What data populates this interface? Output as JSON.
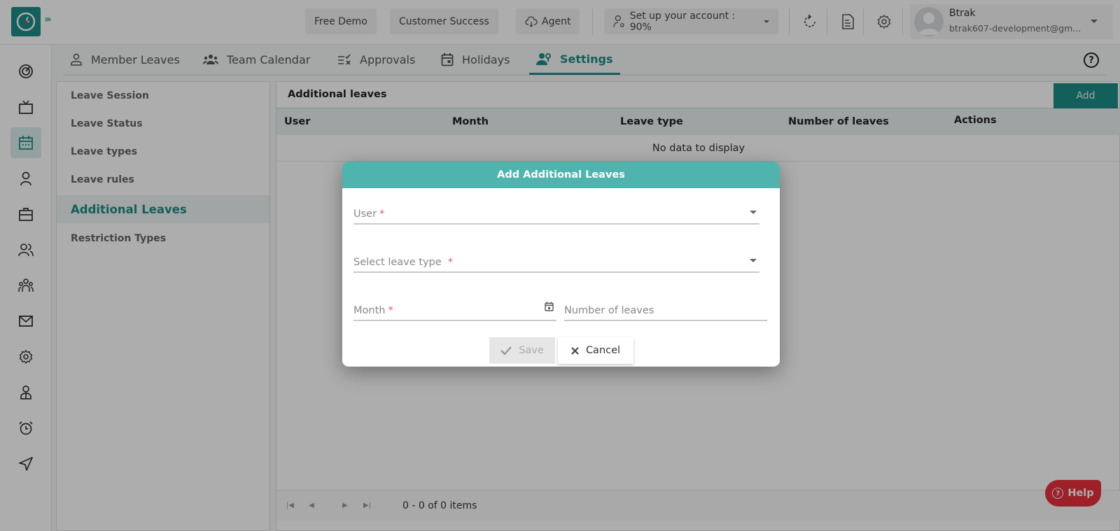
{
  "topbar": {
    "buttons": {
      "free_demo": "Free Demo",
      "customer_success": "Customer Success",
      "agent": "Agent",
      "setup_account": "Set up your account : 90%"
    },
    "setup_progress_percent": 90,
    "user": {
      "name": "Btrak",
      "email": "btrak607-development@gm..."
    }
  },
  "rail": {
    "items": [
      {
        "icon": "dashboard-icon"
      },
      {
        "icon": "tv-icon"
      },
      {
        "icon": "calendar-icon",
        "active": true
      },
      {
        "icon": "user-icon"
      },
      {
        "icon": "briefcase-icon"
      },
      {
        "icon": "users-icon"
      },
      {
        "icon": "team-icon"
      },
      {
        "icon": "mail-icon"
      },
      {
        "icon": "gear-icon"
      },
      {
        "icon": "employee-icon"
      },
      {
        "icon": "alarm-icon"
      },
      {
        "icon": "send-icon"
      }
    ]
  },
  "tabs": [
    {
      "label": "Member Leaves",
      "icon": "person-icon"
    },
    {
      "label": "Team Calendar",
      "icon": "group-icon"
    },
    {
      "label": "Approvals",
      "icon": "checklist-icon"
    },
    {
      "label": "Holidays",
      "icon": "calendar-icon"
    },
    {
      "label": "Settings",
      "icon": "user-gear-icon",
      "active": true
    }
  ],
  "settings_menu": [
    {
      "label": "Leave Session"
    },
    {
      "label": "Leave Status"
    },
    {
      "label": "Leave types"
    },
    {
      "label": "Leave rules"
    },
    {
      "label": "Additional Leaves",
      "active": true
    },
    {
      "label": "Restriction Types"
    }
  ],
  "panel": {
    "title": "Additional leaves",
    "add_label": "Add",
    "columns": [
      "User",
      "Month",
      "Leave type",
      "Number of leaves",
      "Actions"
    ],
    "empty_text": "No data to display",
    "pager_info": "0 - 0 of 0 items"
  },
  "dialog": {
    "title": "Add Additional Leaves",
    "fields": {
      "user": {
        "label": "User",
        "required": "*",
        "value": ""
      },
      "leave_type": {
        "label": "Select leave type",
        "required": "*",
        "value": ""
      },
      "month": {
        "label": "Month",
        "required": "*",
        "value": ""
      },
      "number_of_leaves": {
        "label": "Number of leaves",
        "value": ""
      }
    },
    "save_label": "Save",
    "cancel_label": "Cancel"
  },
  "help": {
    "label": "Help"
  },
  "colors": {
    "brand": "#1c8c86",
    "dialog_header": "#4fb3ae",
    "help": "#e9323f",
    "required": "#e05b5b"
  }
}
